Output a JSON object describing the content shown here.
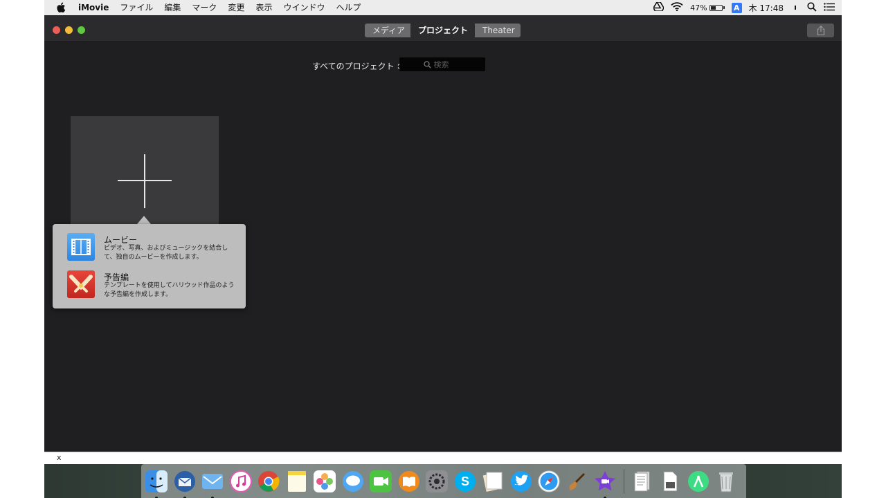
{
  "menubar": {
    "app_name": "iMovie",
    "menus": [
      "ファイル",
      "編集",
      "マーク",
      "変更",
      "表示",
      "ウインドウ",
      "ヘルプ"
    ],
    "battery_percent": "47%",
    "battery_level": 0.47,
    "input_source": "A",
    "clock": "木 17:48"
  },
  "titlebar": {
    "tabs": [
      "メディア",
      "プロジェクト",
      "Theater"
    ],
    "selected_tab": "プロジェクト"
  },
  "browser": {
    "filter_label": "すべてのプロジェクト",
    "search_placeholder": "検索"
  },
  "popover": {
    "options": [
      {
        "title": "ムービー",
        "description": "ビデオ、写真、およびミュージックを結合して、独自のムービーを作成します。",
        "icon": "film-icon"
      },
      {
        "title": "予告編",
        "description": "テンプレートを使用してハリウッド作品のような予告編を作成します。",
        "icon": "trailer-icon"
      }
    ]
  },
  "bottom_strip": {
    "close_label": "x"
  },
  "dock": {
    "apps": [
      {
        "name": "Finder",
        "icon": "finder-icon",
        "running": true
      },
      {
        "name": "Thunderbird",
        "icon": "thunderbird-icon",
        "running": true
      },
      {
        "name": "Mail",
        "icon": "mail-icon",
        "running": true
      },
      {
        "name": "iTunes",
        "icon": "itunes-icon",
        "running": false
      },
      {
        "name": "Chrome",
        "icon": "chrome-icon",
        "running": false
      },
      {
        "name": "Notes",
        "icon": "notes-icon",
        "running": false
      },
      {
        "name": "Photos",
        "icon": "photos-icon",
        "running": false
      },
      {
        "name": "Messages",
        "icon": "messages-icon",
        "running": false
      },
      {
        "name": "FaceTime",
        "icon": "facetime-icon",
        "running": false
      },
      {
        "name": "iBooks",
        "icon": "ibooks-icon",
        "running": false
      },
      {
        "name": "System Preferences",
        "icon": "system-preferences-icon",
        "running": false
      },
      {
        "name": "Skype",
        "icon": "skype-icon",
        "running": false
      },
      {
        "name": "Preview",
        "icon": "preview-icon",
        "running": false
      },
      {
        "name": "Twitter",
        "icon": "twitter-icon",
        "running": false
      },
      {
        "name": "Safari",
        "icon": "safari-icon",
        "running": false
      },
      {
        "name": "GarageBand",
        "icon": "garageband-icon",
        "running": false
      },
      {
        "name": "iMovie",
        "icon": "imovie-icon",
        "running": true
      }
    ],
    "extras": [
      {
        "name": "Documents",
        "icon": "documents-stack-icon"
      },
      {
        "name": "File",
        "icon": "file-icon"
      },
      {
        "name": "Android Studio",
        "icon": "android-studio-icon"
      },
      {
        "name": "Trash",
        "icon": "trash-icon"
      }
    ]
  },
  "colors": {
    "menubar_bg": "#ececec",
    "window_bg": "#1f1f21",
    "titlebar_bg": "#2b2b2d",
    "popover_bg": "#bdbdbd",
    "close": "#ee5e56",
    "minimize": "#f3bd3b",
    "zoom": "#5fc83f",
    "movie_icon": "#3a93ea",
    "trailer_icon": "#d9342b"
  }
}
